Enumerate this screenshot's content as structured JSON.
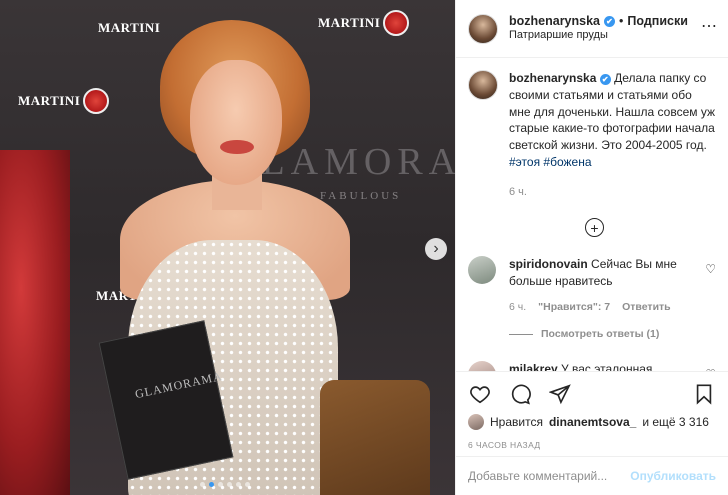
{
  "post": {
    "username": "bozhenarynska",
    "verified_mark": "✔",
    "separator": "•",
    "follow_label": "Подписки",
    "location": "Патриаршие пруды",
    "more_icon": "⋯"
  },
  "photo": {
    "brand_logo": "MARTINI",
    "backdrop_text": "GLAMORAMA",
    "backdrop_sub": "FABULOUS",
    "book_title": "GLAMORAMA",
    "carousel_count": 6,
    "carousel_active": 1
  },
  "caption": {
    "username": "bozhenarynska",
    "text": "Делала папку со своими статьями и статьями обо мне для доченьки. Нашла совсем уж старые какие-то фотографии начала светской жизни. Это 2004-2005 год.",
    "tags": [
      "#этоя",
      "#божена"
    ],
    "time": "6 ч."
  },
  "comments": [
    {
      "username": "spiridonovain",
      "text": "Сейчас Вы мне больше нравитесь",
      "time": "6 ч.",
      "likes": "\"Нравится\": 7",
      "reply_label": "Ответить",
      "replies_label": "Посмотреть ответы (1)"
    },
    {
      "username": "milakrey",
      "text": "У вас эталонная внешность эпохи нулевых"
    }
  ],
  "likes": {
    "prefix": "Нравится",
    "user": "dinanemtsova_",
    "suffix": "и ещё 3 316"
  },
  "posted": "6 ЧАСОВ НАЗАД",
  "add_comment": {
    "placeholder": "Добавьте комментарий...",
    "publish_label": "Опубликовать"
  },
  "colors": {
    "link": "#003569",
    "verified": "#3897f0",
    "publish_disabled": "#b2dffc",
    "muted": "#8e8e8e"
  }
}
